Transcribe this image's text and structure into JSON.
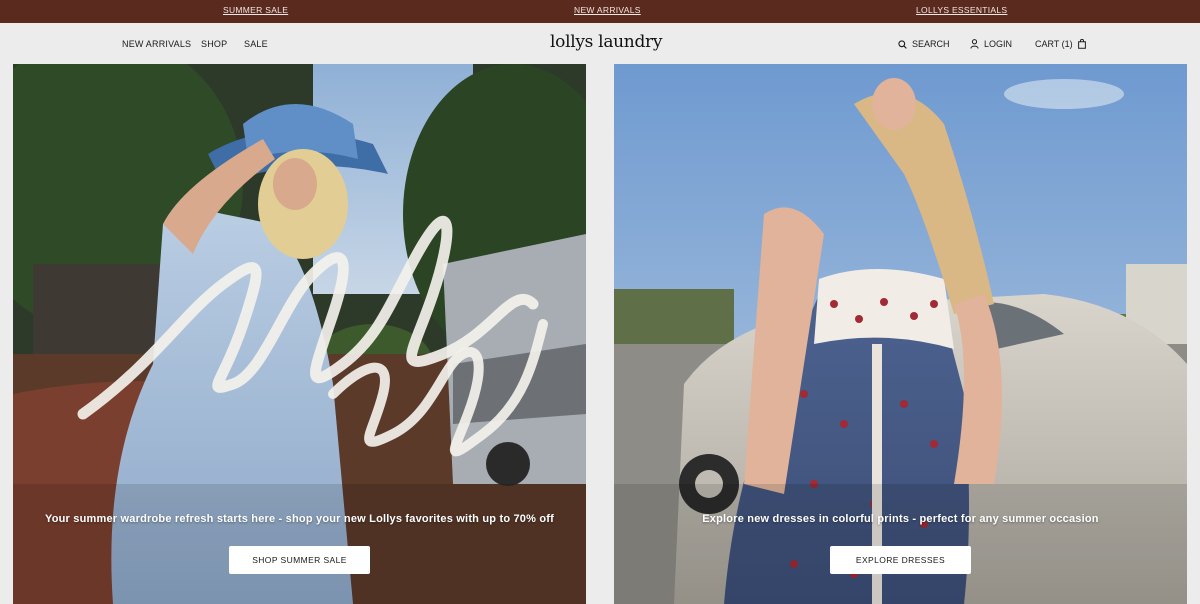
{
  "announcement": {
    "links": [
      "SUMMER SALE",
      "NEW ARRIVALS",
      "LOLLYS ESSENTIALS"
    ]
  },
  "header": {
    "nav_left": [
      "NEW ARRIVALS",
      "SHOP",
      "SALE"
    ],
    "logo": "lollys laundry",
    "search_label": "SEARCH",
    "login_label": "LOGIN",
    "cart_label": "CART (1)"
  },
  "hero_left": {
    "script_text": "summer sale",
    "tagline": "Your summer wardrobe refresh starts here - shop your new Lollys favorites with up to 70% off",
    "button_label": "SHOP SUMMER SALE"
  },
  "hero_right": {
    "tagline": "Explore new dresses in colorful prints - perfect for any summer occasion",
    "button_label": "EXPLORE DRESSES"
  },
  "colors": {
    "announcement_bg": "#5a2a1f",
    "header_bg": "#ececec",
    "button_bg": "#ffffff"
  }
}
